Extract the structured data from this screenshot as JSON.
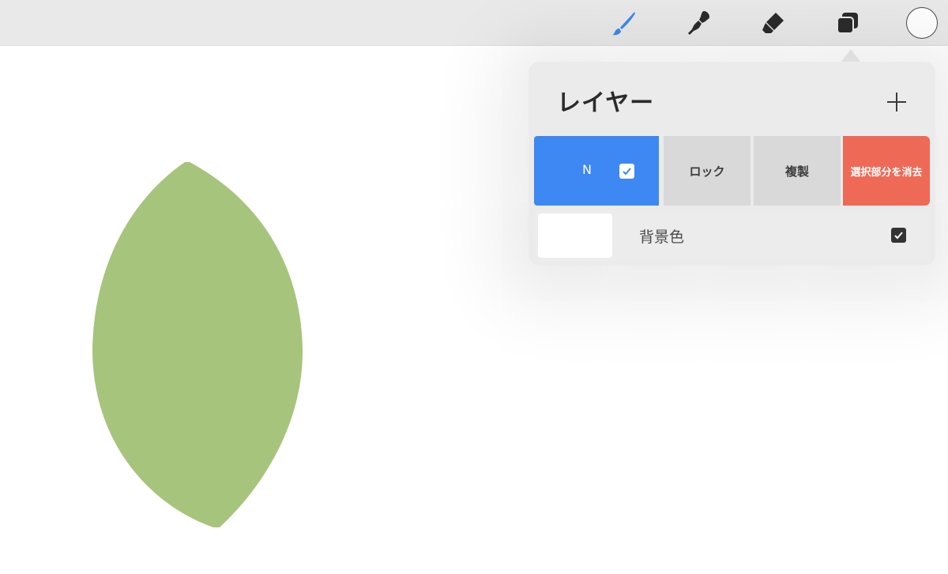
{
  "toolbar": {
    "tools": [
      {
        "name": "brush-icon",
        "color": "#3d88f2",
        "active": true
      },
      {
        "name": "smudge-icon",
        "color": "#2b2b2b",
        "active": false
      },
      {
        "name": "eraser-icon",
        "color": "#2b2b2b",
        "active": false
      },
      {
        "name": "layers-icon",
        "color": "#2b2b2b",
        "active": false
      }
    ],
    "current_color": "#ffffff"
  },
  "canvas": {
    "background": "#ffffff",
    "shape": {
      "name": "leaf-shape",
      "fill": "#a6c47b"
    }
  },
  "layers_panel": {
    "title": "レイヤー",
    "add_icon": "plus-icon",
    "layer_actions": {
      "layer_letter": "N",
      "visible_checked": true,
      "lock_label": "ロック",
      "duplicate_label": "複製",
      "clear_label": "選択部分を消去"
    },
    "background_row": {
      "label": "背景色",
      "thumbnail_color": "#ffffff",
      "visible_checked": true
    }
  },
  "colors": {
    "accent_blue": "#3d88f2",
    "danger_red": "#ee6a56",
    "panel_bg": "#ebebeb",
    "button_gray": "#d9d9d9"
  }
}
